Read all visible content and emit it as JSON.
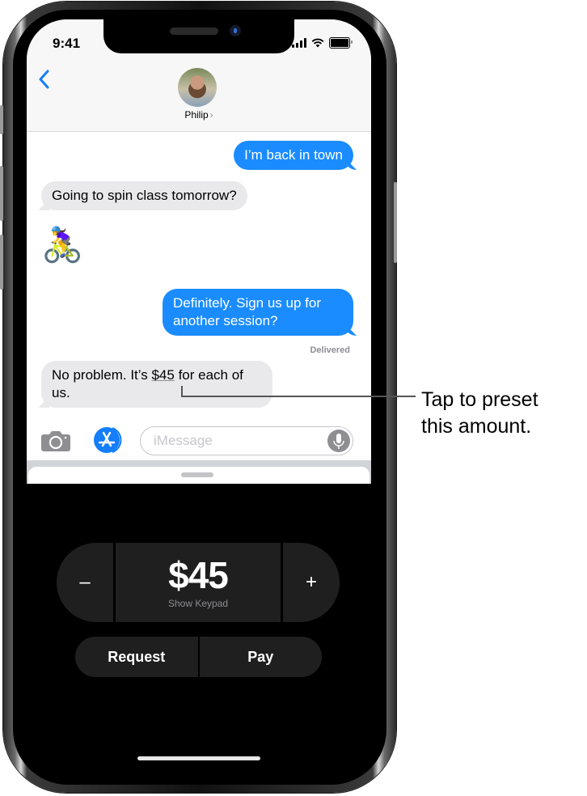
{
  "status_bar": {
    "time": "9:41",
    "signal_icon": "cellular-signal-icon",
    "wifi_icon": "wifi-icon",
    "battery_icon": "battery-icon"
  },
  "header": {
    "back_icon": "chevron-left-icon",
    "contact_name": "Philip",
    "contact_chevron": "›",
    "avatar": "contact-avatar-photo"
  },
  "messages": [
    {
      "direction": "outgoing",
      "text": "I’m back in town"
    },
    {
      "direction": "incoming",
      "text": "Going to spin class tomorrow?"
    },
    {
      "direction": "incoming",
      "emoji": "🚴‍♀️",
      "emoji_name": "woman-biking"
    },
    {
      "direction": "outgoing",
      "text": "Definitely. Sign us up for another session?"
    },
    {
      "direction": "incoming",
      "text_before": "No problem. It’s ",
      "amount_link": "$45",
      "text_after": " for each of us."
    }
  ],
  "delivered_label": "Delivered",
  "input_bar": {
    "placeholder": "iMessage",
    "value": "",
    "camera_icon": "camera-icon",
    "apps_icon": "app-store-icon",
    "mic_icon": "microphone-icon"
  },
  "apple_pay": {
    "minus_label": "–",
    "plus_label": "+",
    "amount": "$45",
    "show_keypad_label": "Show Keypad",
    "request_label": "Request",
    "pay_label": "Pay"
  },
  "callout": {
    "text_line1": "Tap to preset",
    "text_line2": "this amount."
  },
  "colors": {
    "outgoing_bubble": "#1a8cff",
    "incoming_bubble": "#e9e9eb",
    "accent": "#147efb",
    "pay_panel": "#1f1f1f"
  }
}
